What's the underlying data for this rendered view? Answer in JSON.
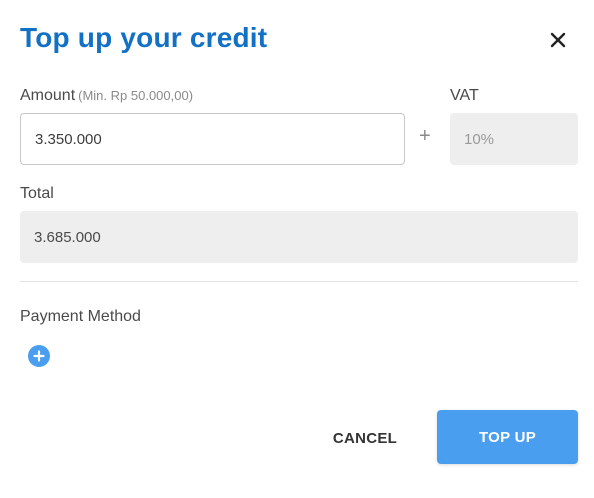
{
  "dialog": {
    "title": "Top up your credit",
    "close_icon": "close-icon"
  },
  "form": {
    "amount_label": "Amount",
    "amount_hint": "(Min. Rp 50.000,00)",
    "amount_value": "3.350.000",
    "plus_symbol": "+",
    "vat_label": "VAT",
    "vat_value": "10%",
    "total_label": "Total",
    "total_value": "3.685.000",
    "payment_method_label": "Payment Method",
    "add_payment_icon": "plus-circle-icon"
  },
  "actions": {
    "cancel_label": "CANCEL",
    "topup_label": "TOP UP"
  },
  "colors": {
    "title": "#1271c4",
    "primary_button": "#4a9ef0",
    "readonly_field": "#eeeeee"
  }
}
